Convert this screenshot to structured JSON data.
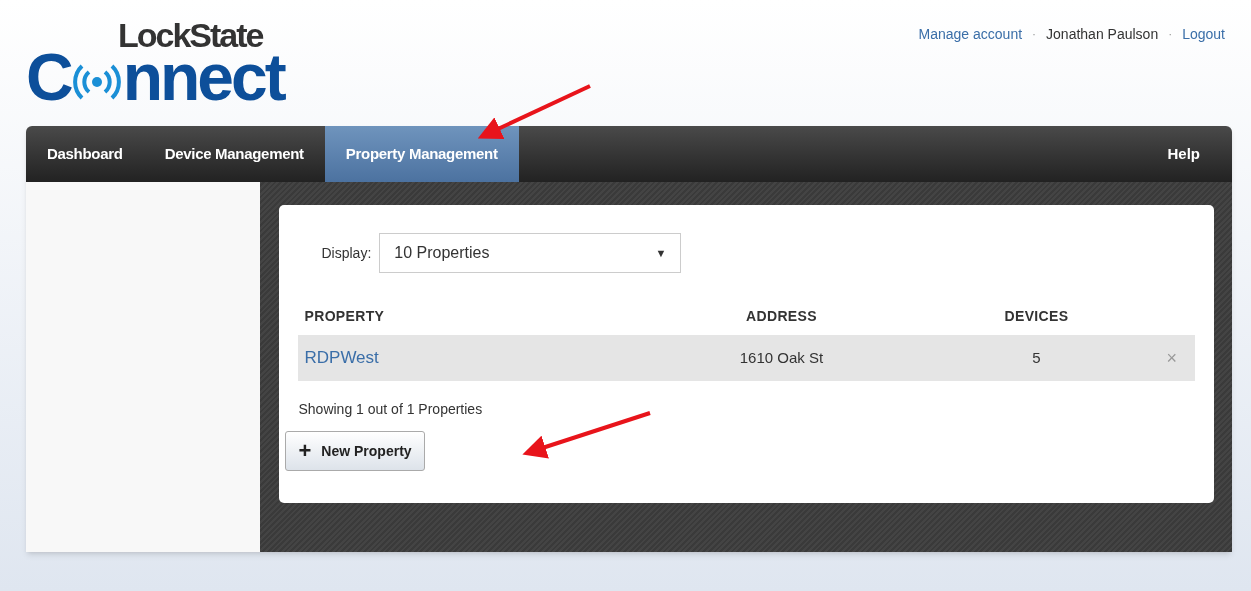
{
  "logo": {
    "top": "LockState",
    "first": "C",
    "rest": "nnect"
  },
  "account_links": [
    {
      "kind": "link",
      "label": "Manage account"
    },
    {
      "kind": "separator",
      "label": "·"
    },
    {
      "kind": "text",
      "label": "Jonathan Paulson"
    },
    {
      "kind": "separator",
      "label": "·"
    },
    {
      "kind": "link",
      "label": "Logout"
    }
  ],
  "tabs": [
    {
      "label": "Dashboard",
      "selected": false
    },
    {
      "label": "Device Management",
      "selected": false
    },
    {
      "label": "Property Management",
      "selected": true
    }
  ],
  "help": "Help",
  "display": {
    "label": "Display:",
    "value": "10 Properties",
    "arrow": "▼"
  },
  "table": {
    "columns": [
      "PROPERTY",
      "ADDRESS",
      "DEVICES"
    ],
    "rows": [
      {
        "property": "RDPWest",
        "address": "1610 Oak St",
        "devices": "5",
        "delete": "×"
      }
    ]
  },
  "summary": "Showing 1 out of 1 Properties",
  "new_button": {
    "icon": "+",
    "label": "New Property"
  }
}
